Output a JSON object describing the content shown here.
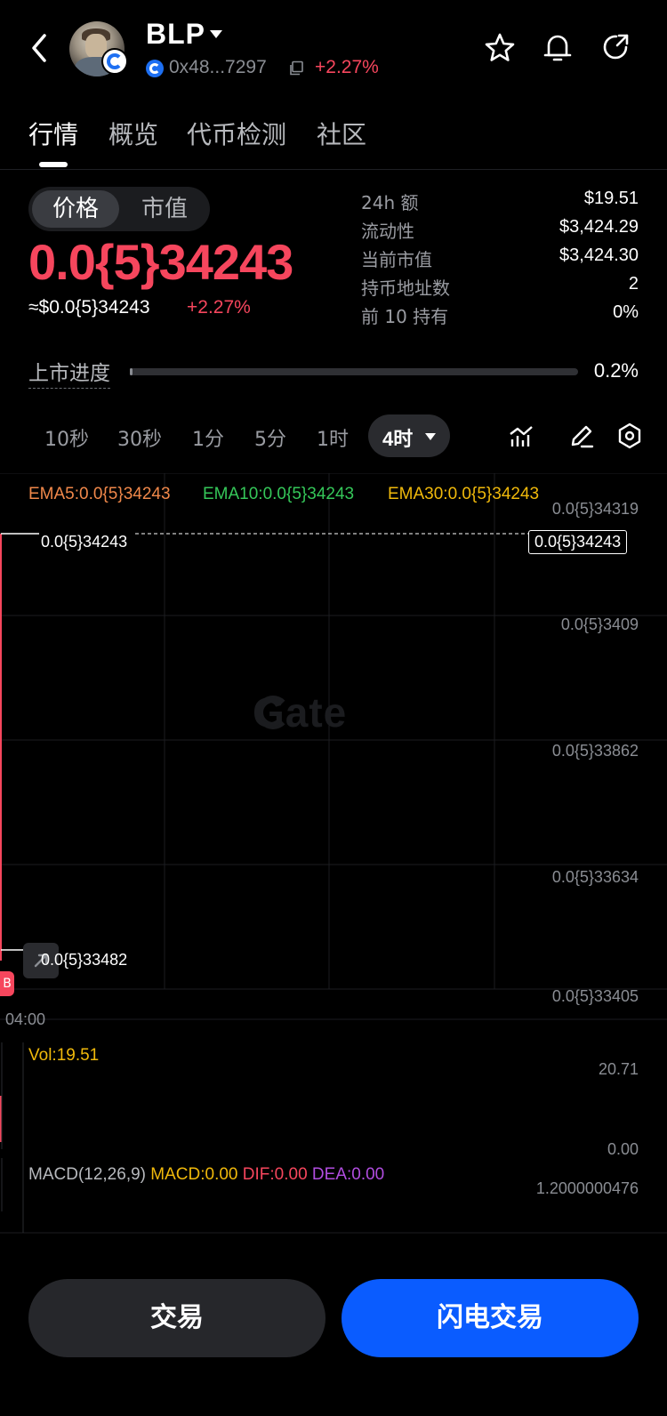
{
  "header": {
    "title": "BLP",
    "address": "0x48...7297",
    "change": "+2.27%"
  },
  "tabs": [
    {
      "label": "行情",
      "active": true
    },
    {
      "label": "概览",
      "active": false
    },
    {
      "label": "代币检测",
      "active": false
    },
    {
      "label": "社区",
      "active": false
    }
  ],
  "price_toggle": {
    "price_label": "价格",
    "mcap_label": "市值",
    "selected": "价格"
  },
  "price": {
    "big": "0.0{5}34243",
    "usd": "≈$0.0{5}34243",
    "change": "+2.27%"
  },
  "stats": [
    {
      "label": "24h   额",
      "value": "$19.51"
    },
    {
      "label": "流动性",
      "value": "$3,424.29"
    },
    {
      "label": "当前市值",
      "value": "$3,424.30"
    },
    {
      "label": "持币地址数",
      "value": "2"
    },
    {
      "label": "前 10 持有",
      "value": "0%"
    }
  ],
  "listing_progress": {
    "label": "上市进度",
    "value_text": "0.2%",
    "fraction": 0.002
  },
  "intervals": [
    "10秒",
    "30秒",
    "1分",
    "5分",
    "1时"
  ],
  "interval_selected": "4时",
  "chart": {
    "ema5": "EMA5:0.0{5}34243",
    "ema10": "EMA10:0.0{5}34243",
    "ema30": "EMA30:0.0{5}34243",
    "y_axis": [
      "0.0{5}34319",
      "0.0{5}3409",
      "0.0{5}33862",
      "0.0{5}33634",
      "0.0{5}33405"
    ],
    "high_label": "0.0{5}34243",
    "low_label": "0.0{5}33482",
    "current_tag": "0.0{5}34243",
    "watermark": "Gate",
    "time_label": "04:00",
    "red_tag": "B",
    "vol": "Vol:19.51",
    "vol_axis": [
      "20.71",
      "0.00"
    ],
    "macd_title": "MACD(12,26,9)",
    "macd": "MACD:0.00",
    "dif": "DIF:0.00",
    "dea": "DEA:0.00",
    "macd_axis": "1.2000000476"
  },
  "colors": {
    "up": "#f6465d",
    "ema5": "#f0884a",
    "ema10": "#35c759",
    "ema30": "#f0b90b",
    "macd": "#f0b90b",
    "dif": "#f6465d",
    "dea": "#b14de0",
    "primary_button": "#0a5cff"
  },
  "buttons": {
    "trade": "交易",
    "flash_trade": "闪电交易"
  }
}
